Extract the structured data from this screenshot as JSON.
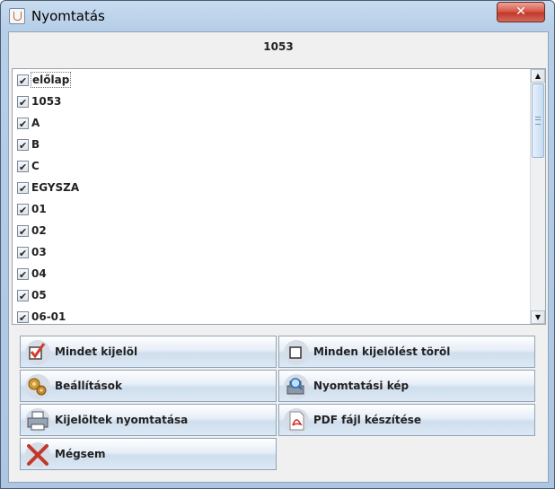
{
  "window": {
    "title": "Nyomtatás",
    "close_label": "✕"
  },
  "header": {
    "title": "1053"
  },
  "list": {
    "items": [
      "előlap",
      "1053",
      "A",
      "B",
      "C",
      "EGYSZA",
      "01",
      "02",
      "03",
      "04",
      "05",
      "06-01"
    ]
  },
  "buttons": {
    "select_all": "Mindet kijelöl",
    "deselect_all": "Minden kijelölést töröl",
    "settings": "Beállítások",
    "preview": "Nyomtatási kép",
    "print_selected": "Kijelöltek nyomtatása",
    "pdf": "PDF fájl készítése",
    "cancel": "Mégsem"
  },
  "icons": {
    "select_all": "checked-box-icon",
    "deselect_all": "empty-box-icon",
    "settings": "settings-icon",
    "preview": "print-preview-icon",
    "print_selected": "printer-icon",
    "pdf": "pdf-icon",
    "cancel": "cancel-x-icon"
  },
  "colors": {
    "accent": "#3a86d6",
    "pdf": "#d22a2a",
    "cancel": "#c0392b"
  }
}
